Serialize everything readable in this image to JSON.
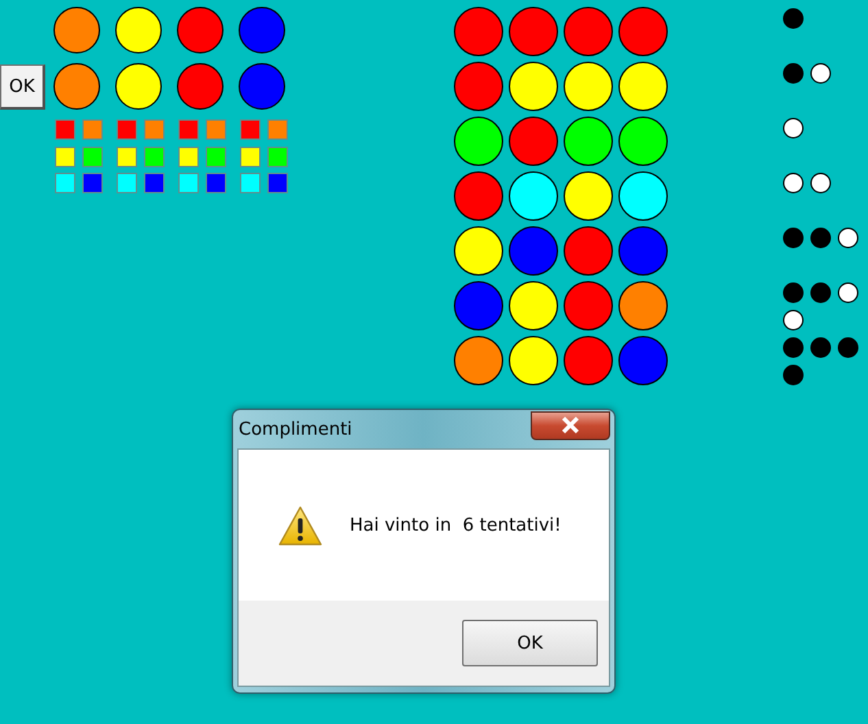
{
  "ok_button": "OK",
  "code_rows": [
    {
      "pegs": [
        {
          "color": "#ff8000"
        },
        {
          "color": "#ffff00"
        },
        {
          "color": "#ff0000"
        },
        {
          "color": "#0000ff"
        }
      ]
    },
    {
      "pegs": [
        {
          "color": "#ff8000"
        },
        {
          "color": "#ffff00"
        },
        {
          "color": "#ff0000"
        },
        {
          "color": "#0000ff"
        }
      ]
    }
  ],
  "palette": [
    {
      "swatches": [
        {
          "color": "#ff0000"
        },
        {
          "color": "#ff8000"
        },
        {
          "color": "#ffff00"
        },
        {
          "color": "#00ff00"
        },
        {
          "color": "#00ffff"
        },
        {
          "color": "#0000ff"
        }
      ]
    },
    {
      "swatches": [
        {
          "color": "#ff0000"
        },
        {
          "color": "#ff8000"
        },
        {
          "color": "#ffff00"
        },
        {
          "color": "#00ff00"
        },
        {
          "color": "#00ffff"
        },
        {
          "color": "#0000ff"
        }
      ]
    },
    {
      "swatches": [
        {
          "color": "#ff0000"
        },
        {
          "color": "#ff8000"
        },
        {
          "color": "#ffff00"
        },
        {
          "color": "#00ff00"
        },
        {
          "color": "#00ffff"
        },
        {
          "color": "#0000ff"
        }
      ]
    },
    {
      "swatches": [
        {
          "color": "#ff0000"
        },
        {
          "color": "#ff8000"
        },
        {
          "color": "#ffff00"
        },
        {
          "color": "#00ff00"
        },
        {
          "color": "#00ffff"
        },
        {
          "color": "#0000ff"
        }
      ]
    }
  ],
  "board": [
    {
      "pegs": [
        {
          "color": "#ff0000"
        },
        {
          "color": "#ff0000"
        },
        {
          "color": "#ff0000"
        },
        {
          "color": "#ff0000"
        }
      ],
      "feedback": [
        {
          "color": "#000000"
        }
      ]
    },
    {
      "pegs": [
        {
          "color": "#ff0000"
        },
        {
          "color": "#ffff00"
        },
        {
          "color": "#ffff00"
        },
        {
          "color": "#ffff00"
        }
      ],
      "feedback": [
        {
          "color": "#000000"
        },
        {
          "color": "#ffffff"
        }
      ]
    },
    {
      "pegs": [
        {
          "color": "#00ff00"
        },
        {
          "color": "#ff0000"
        },
        {
          "color": "#00ff00"
        },
        {
          "color": "#00ff00"
        }
      ],
      "feedback": [
        {
          "color": "#ffffff"
        }
      ]
    },
    {
      "pegs": [
        {
          "color": "#ff0000"
        },
        {
          "color": "#00ffff"
        },
        {
          "color": "#ffff00"
        },
        {
          "color": "#00ffff"
        }
      ],
      "feedback": [
        {
          "color": "#ffffff"
        },
        {
          "color": "#ffffff"
        }
      ]
    },
    {
      "pegs": [
        {
          "color": "#ffff00"
        },
        {
          "color": "#0000ff"
        },
        {
          "color": "#ff0000"
        },
        {
          "color": "#0000ff"
        }
      ],
      "feedback": [
        {
          "color": "#000000"
        },
        {
          "color": "#000000"
        },
        {
          "color": "#ffffff"
        }
      ]
    },
    {
      "pegs": [
        {
          "color": "#0000ff"
        },
        {
          "color": "#ffff00"
        },
        {
          "color": "#ff0000"
        },
        {
          "color": "#ff8000"
        }
      ],
      "feedback": [
        {
          "color": "#000000"
        },
        {
          "color": "#000000"
        },
        {
          "color": "#ffffff"
        },
        {
          "color": "#ffffff"
        }
      ]
    },
    {
      "pegs": [
        {
          "color": "#ff8000"
        },
        {
          "color": "#ffff00"
        },
        {
          "color": "#ff0000"
        },
        {
          "color": "#0000ff"
        }
      ],
      "feedback": [
        {
          "color": "#000000"
        },
        {
          "color": "#000000"
        },
        {
          "color": "#000000"
        },
        {
          "color": "#000000"
        }
      ]
    }
  ],
  "dialog": {
    "title": "Complimenti",
    "message": "Hai vinto in  6 tentativi!",
    "button": "OK"
  }
}
